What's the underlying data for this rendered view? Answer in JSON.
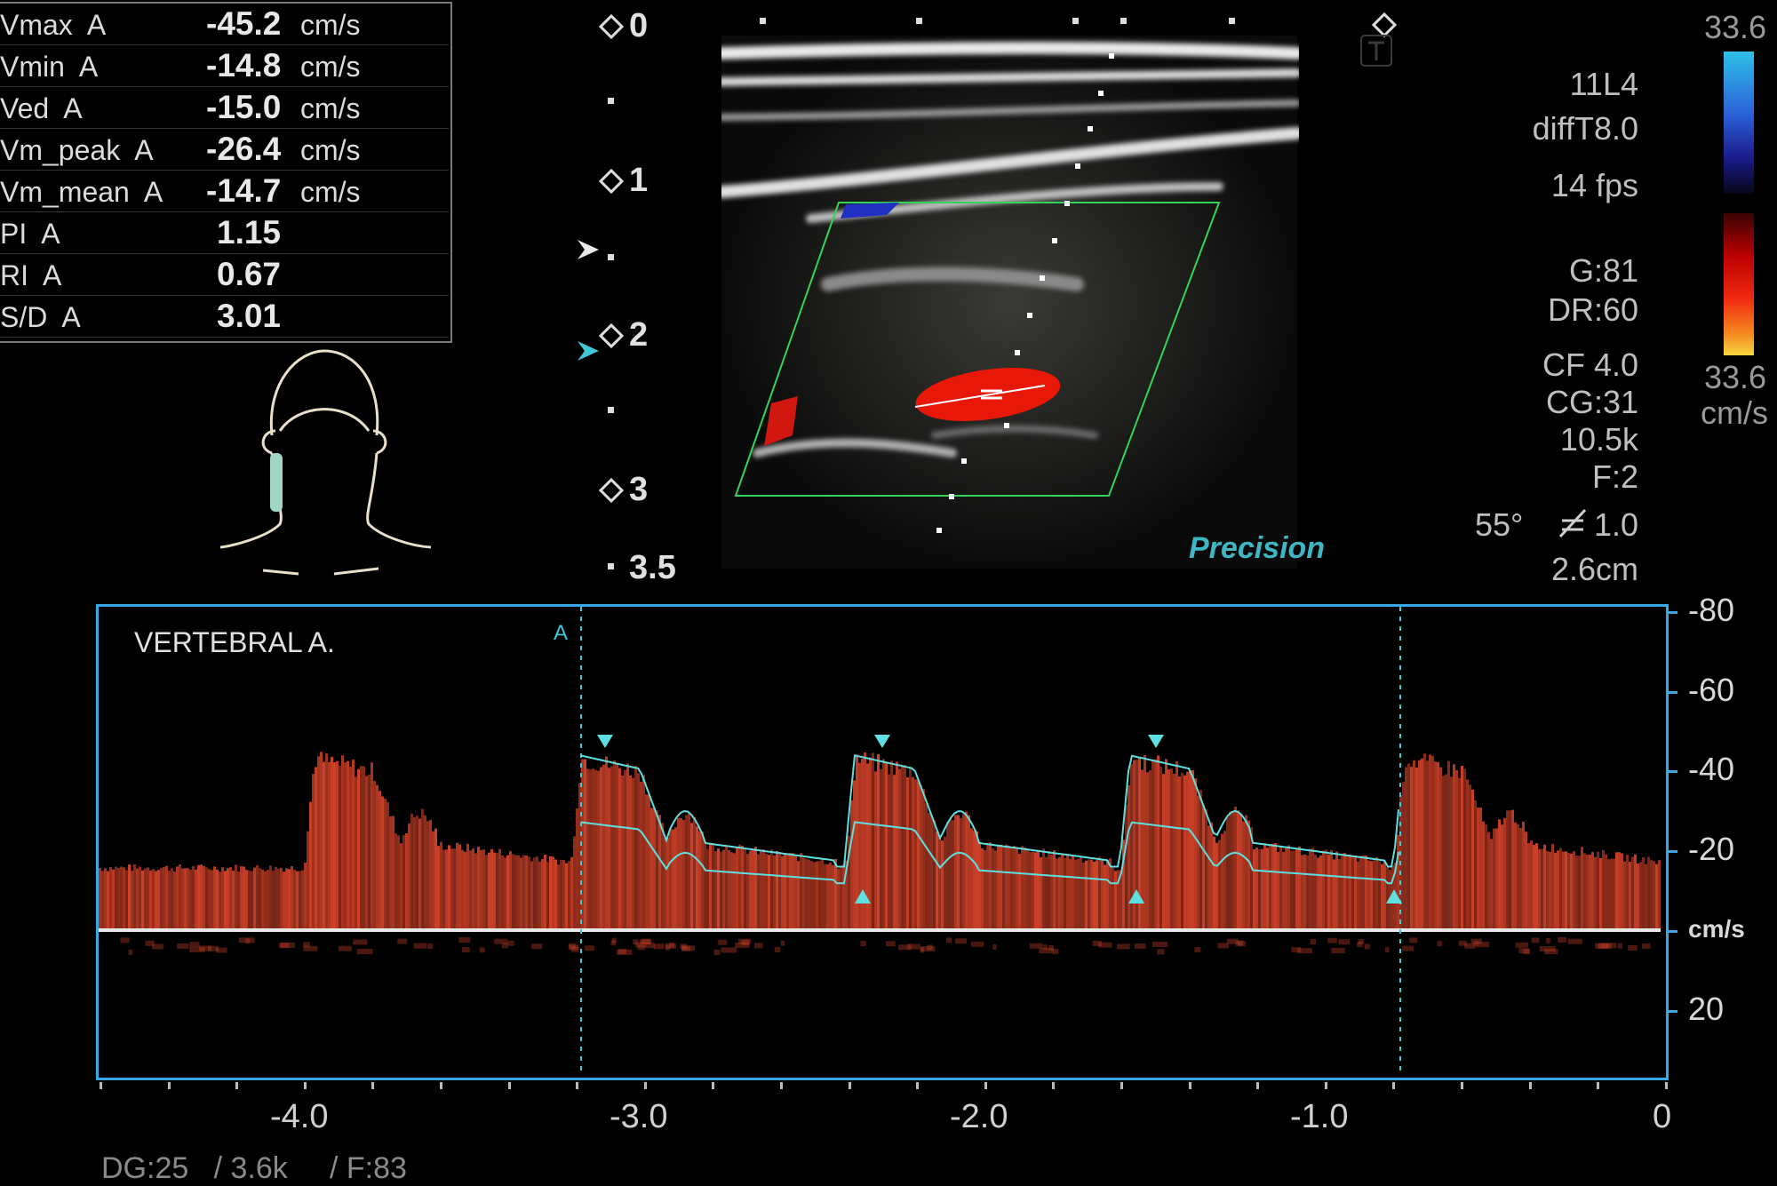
{
  "measurements": [
    {
      "label": "Vmax  A",
      "value": "-45.2",
      "unit": "cm/s"
    },
    {
      "label": "Vmin  A",
      "value": "-14.8",
      "unit": "cm/s"
    },
    {
      "label": "Ved  A",
      "value": "-15.0",
      "unit": "cm/s"
    },
    {
      "label": "Vm_peak  A",
      "value": "-26.4",
      "unit": "cm/s"
    },
    {
      "label": "Vm_mean  A",
      "value": "-14.7",
      "unit": "cm/s"
    },
    {
      "label": "PI  A",
      "value": "1.15",
      "unit": ""
    },
    {
      "label": "RI  A",
      "value": "0.67",
      "unit": ""
    },
    {
      "label": "S/D  A",
      "value": "3.01",
      "unit": ""
    }
  ],
  "depth_scale": [
    "0",
    "1",
    "2",
    "3",
    "3.5"
  ],
  "probe_params": {
    "probe": "11L4",
    "preset": "diffT8.0",
    "fps": "14 fps",
    "gain": "G:81",
    "dynamic_range": "DR:60",
    "cf": "CF 4.0",
    "cg": "CG:31",
    "prf": "10.5k",
    "filter": "F:2",
    "angle": "55°",
    "angle_val": "1.0",
    "depth": "2.6cm"
  },
  "color_scale": {
    "top": "33.6",
    "bottom": "33.6",
    "unit": "cm/s"
  },
  "image_mode_label": "Precision",
  "doppler": {
    "vessel_label": "VERTEBRAL A.",
    "marker_label": "A",
    "y_ticks": [
      "-80",
      "-60",
      "-40",
      "-20",
      "cm/s",
      "20"
    ],
    "x_ticks": [
      "-4.0",
      "-3.0",
      "-2.0",
      "-1.0",
      "0"
    ],
    "footer": "DG:25   / 3.6k     / F:83"
  },
  "colors": {
    "frame": "#39a6e6",
    "trace": "#5fe0e0",
    "spectral": "#d8442a"
  }
}
